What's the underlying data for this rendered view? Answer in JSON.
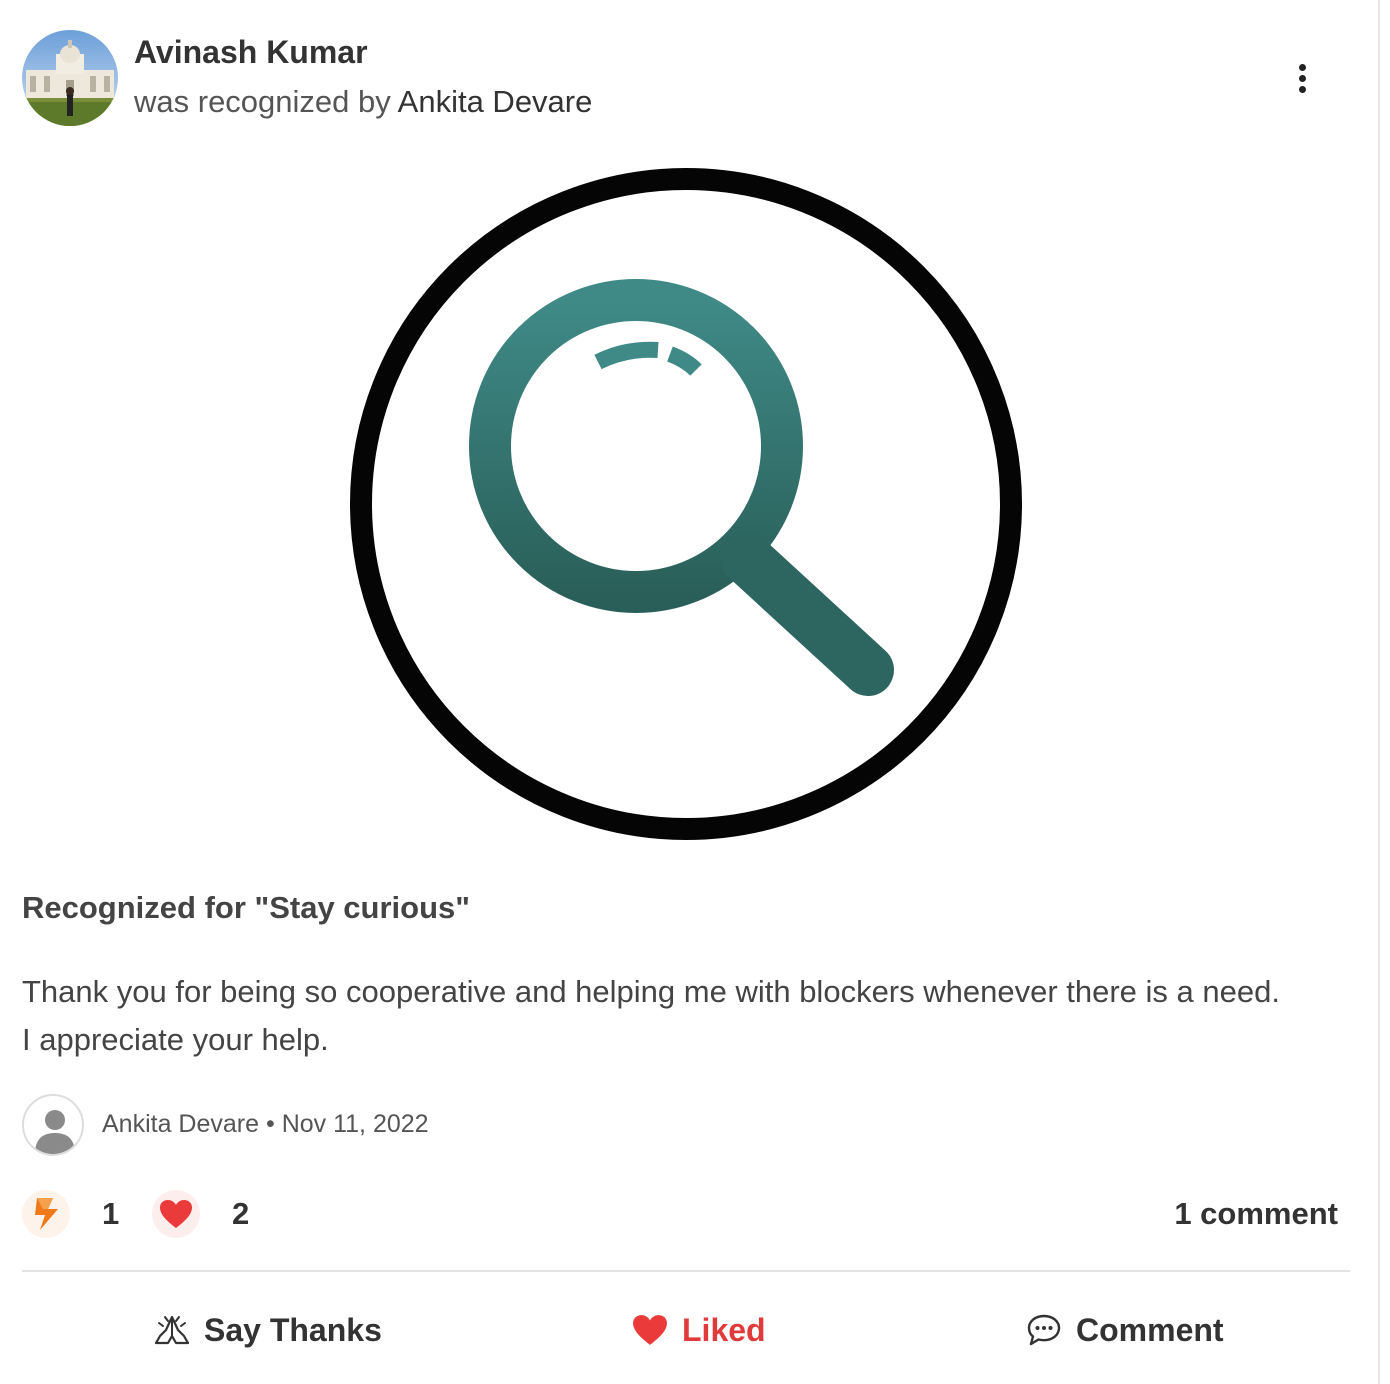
{
  "post": {
    "recipient_name": "Avinash Kumar",
    "recognized_prefix": "was recognized by ",
    "giver_name": "Ankita Devare",
    "value_title": "Recognized for \"Stay curious\"",
    "message_line1": "Thank you for being so cooperative and helping me with blockers whenever there is a need.",
    "message_line2": "I appreciate your help.",
    "author_name": "Ankita Devare",
    "separator": "•",
    "date": "Nov 11, 2022"
  },
  "reactions": {
    "bolt_count": "1",
    "heart_count": "2",
    "comment_count": "1 comment"
  },
  "actions": {
    "say_thanks": "Say Thanks",
    "liked": "Liked",
    "comment": "Comment"
  },
  "icons": {
    "menu": "more-vertical-icon",
    "badge": "magnifying-glass-icon",
    "bolt": "lightning-icon",
    "heart": "heart-icon",
    "thanks": "praying-hands-icon",
    "comment": "speech-bubble-icon"
  },
  "colors": {
    "badge_teal_top": "#3f8a87",
    "badge_teal_bottom": "#2a5f59",
    "liked_red": "#e03a3a",
    "bolt_orange": "#f07a1a"
  }
}
